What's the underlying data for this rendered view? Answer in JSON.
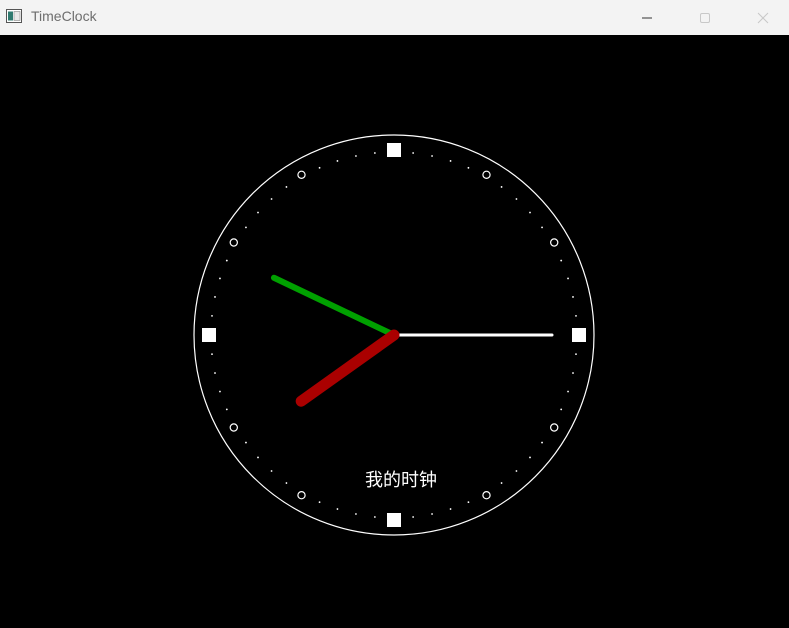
{
  "window": {
    "title": "TimeClock",
    "icon": "app-window-icon",
    "controls": [
      "minimize-icon",
      "maximize-icon",
      "close-icon"
    ]
  },
  "clock": {
    "caption": "我的时钟",
    "colors": {
      "background": "#000000",
      "face_outline": "#ffffff",
      "hour_hand": "#aa0000",
      "minute_hand": "#00a000",
      "second_hand": "#ffffff"
    },
    "time": {
      "hour": 7,
      "minute": 49,
      "second": 15
    }
  }
}
